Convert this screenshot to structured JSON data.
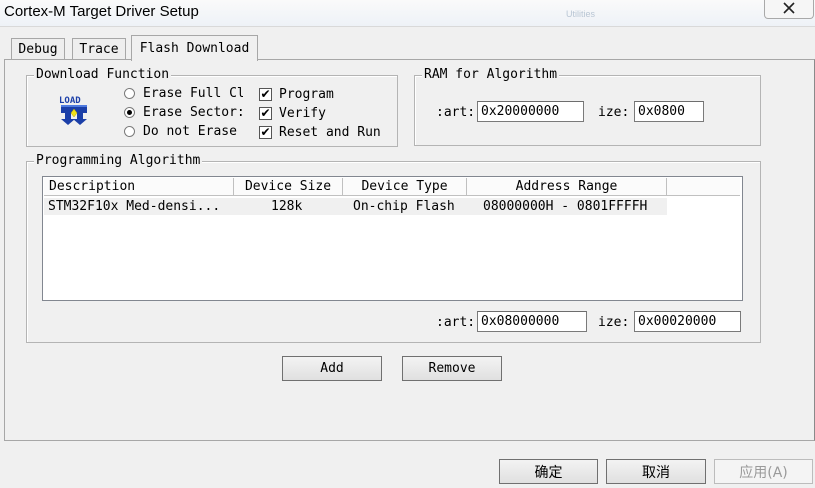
{
  "window": {
    "title": "Cortex-M Target Driver Setup"
  },
  "background_tabs": [
    "Utilities"
  ],
  "tabs": [
    {
      "label": "Debug",
      "active": false
    },
    {
      "label": "Trace",
      "active": false
    },
    {
      "label": "Flash Download",
      "active": true
    }
  ],
  "download_function": {
    "legend": "Download Function",
    "icon_text": "LOAD",
    "erase_options": [
      {
        "label": "Erase Full Cl",
        "selected": false
      },
      {
        "label": "Erase Sector:",
        "selected": true
      },
      {
        "label": "Do not Erase",
        "selected": false
      }
    ],
    "checkboxes": [
      {
        "label": "Program",
        "checked": true
      },
      {
        "label": "Verify",
        "checked": true
      },
      {
        "label": "Reset and Run",
        "checked": true
      }
    ]
  },
  "ram_for_algorithm": {
    "legend": "RAM for Algorithm",
    "start_label": ":art:",
    "start_value": "0x20000000",
    "size_label": "ize:",
    "size_value": "0x0800"
  },
  "programming_algorithm": {
    "legend": "Programming Algorithm",
    "columns": [
      "Description",
      "Device Size",
      "Device Type",
      "Address Range"
    ],
    "rows": [
      {
        "description": "STM32F10x Med-densi...",
        "device_size": "128k",
        "device_type": "On-chip Flash",
        "address_range": "08000000H - 0801FFFFH"
      }
    ],
    "start_label": ":art:",
    "start_value": "0x08000000",
    "size_label": "ize:",
    "size_value": "0x00020000"
  },
  "buttons": {
    "add": "Add",
    "remove": "Remove"
  },
  "footer": {
    "ok": "确定",
    "cancel": "取消",
    "apply": "应用(A)"
  },
  "colors": {
    "face": "#f0f0f0",
    "selected_row": "#f0f0f0",
    "icon_blue": "#1b3fa8",
    "icon_yellow": "#f2e21a"
  }
}
